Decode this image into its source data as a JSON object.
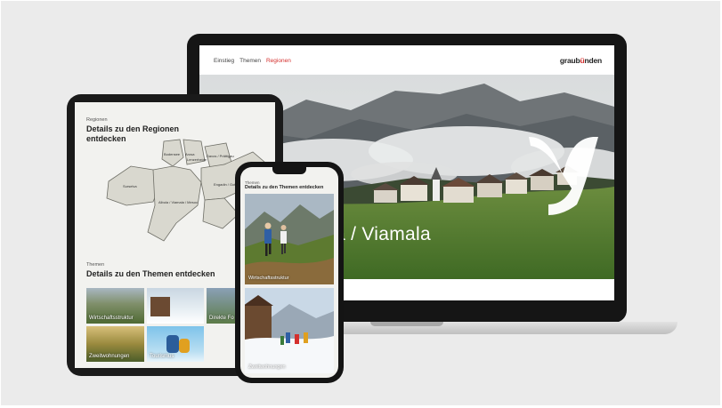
{
  "laptop": {
    "nav": {
      "items": [
        "Einstieg",
        "Themen",
        "Regionen"
      ],
      "active_index": 2
    },
    "logo": "graubünden",
    "hero_title": "a / Viamala"
  },
  "tablet": {
    "regions_kicker": "Regionen",
    "regions_heading": "Details zu den Regionen entdecken",
    "map_regions": [
      "Surselva",
      "Rheintal",
      "Bodensee",
      "Arosa",
      "Lenzerheide",
      "Davos / Prättigau",
      "Albula / Viamala / Mesoc",
      "Engadin / Gotthard"
    ],
    "themes_kicker": "Themen",
    "themes_heading": "Details zu den Themen entdecken",
    "tiles": [
      "Wirtschaftsstruktur",
      "",
      "Direkte Fo",
      "Zweitwohnungen",
      "Tourismus"
    ]
  },
  "phone": {
    "kicker": "Themen",
    "heading": "Details zu den Themen entdecken",
    "cards": [
      "Wirtschaftsstruktur",
      "Zweitwohnungen"
    ]
  },
  "colors": {
    "accent": "#d4302e",
    "dark": "#151515",
    "bg": "#ebebeb",
    "paper": "#f2f2ef"
  }
}
